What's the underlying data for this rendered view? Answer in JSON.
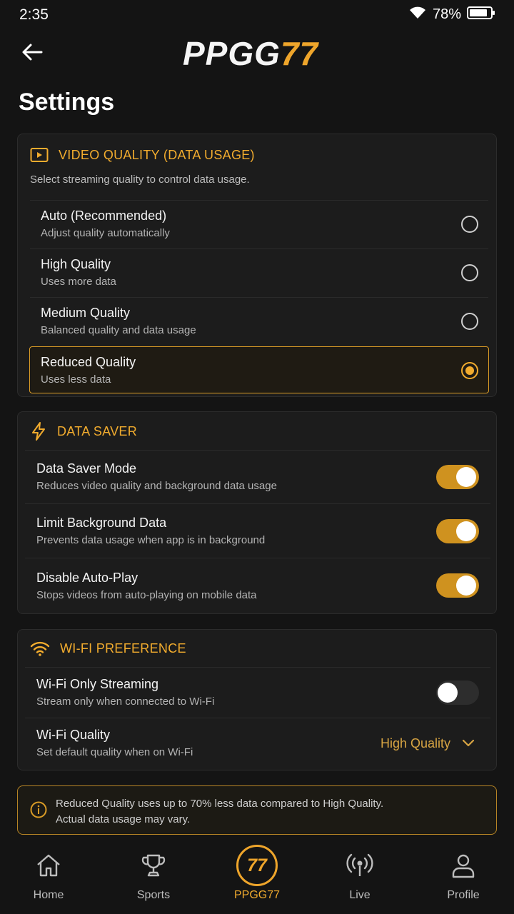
{
  "status_bar": {
    "time": "2:35",
    "battery": "78%"
  },
  "header": {
    "logo_text": "PPGG",
    "logo_number": "77"
  },
  "page_title": "Settings",
  "video_quality": {
    "title": "VIDEO QUALITY (DATA USAGE)",
    "description": "Select streaming quality to control data usage.",
    "options": [
      {
        "label": "Auto (Recommended)",
        "sub": "Adjust quality automatically",
        "selected": false
      },
      {
        "label": "High Quality",
        "sub": "Uses more data",
        "selected": false
      },
      {
        "label": "Medium Quality",
        "sub": "Balanced quality and data usage",
        "selected": false
      },
      {
        "label": "Reduced Quality",
        "sub": "Uses less data",
        "selected": true
      }
    ]
  },
  "data_saver": {
    "title": "DATA SAVER",
    "rows": [
      {
        "label": "Data Saver Mode",
        "sub": "Reduces video quality and background data usage",
        "on": true
      },
      {
        "label": "Limit Background Data",
        "sub": "Prevents data usage when app is in background",
        "on": true
      },
      {
        "label": "Disable Auto-Play",
        "sub": "Stops videos from auto-playing on mobile data",
        "on": true
      }
    ]
  },
  "wifi_preference": {
    "title": "WI-FI PREFERENCE",
    "streaming": {
      "label": "Wi-Fi Only Streaming",
      "sub": "Stream only when connected to Wi-Fi",
      "on": false
    },
    "quality": {
      "label": "Wi-Fi Quality",
      "sub": "Set default quality when on Wi-Fi",
      "value": "High Quality"
    }
  },
  "info": {
    "line1": "Reduced Quality uses up to 70% less data compared to High Quality.",
    "line2": "Actual data usage may vary."
  },
  "bottom_nav": [
    {
      "label": "Home",
      "icon": "home-icon"
    },
    {
      "label": "Sports",
      "icon": "trophy-icon"
    },
    {
      "label": "PPGG77",
      "icon": "ppgg77-badge-icon",
      "badge": "77",
      "active": true
    },
    {
      "label": "Live",
      "icon": "broadcast-icon"
    },
    {
      "label": "Profile",
      "icon": "user-icon"
    }
  ],
  "colors": {
    "accent": "#f2ac2e",
    "background": "#141414",
    "card": "#1c1c1c"
  }
}
